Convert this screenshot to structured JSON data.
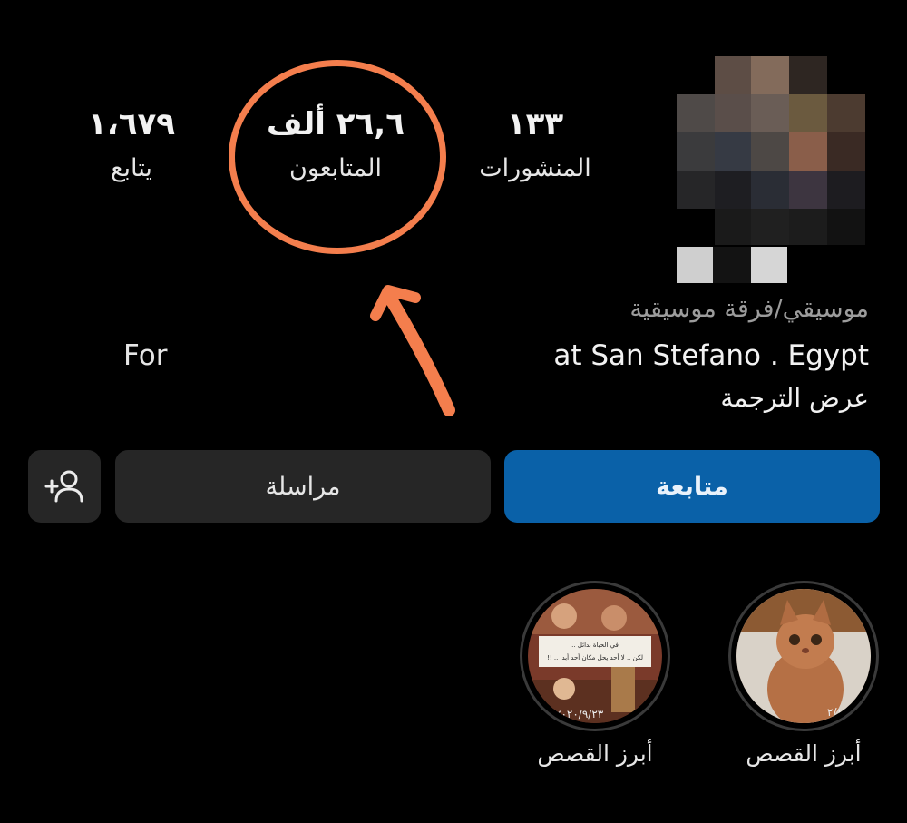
{
  "stats": {
    "posts": {
      "value": "١٣٣",
      "label": "المنشورات"
    },
    "followers": {
      "value": "٢٦,٦ ألف",
      "label": "المتابعون"
    },
    "following": {
      "value": "١،٦٧٩",
      "label": "يتابع"
    }
  },
  "bio": {
    "category": "موسيقي/فرقة موسيقية",
    "location": "at San Stefano . Egypt",
    "for_text": "For",
    "see_translation": "عرض الترجمة"
  },
  "buttons": {
    "follow": "متابعة",
    "message": "مراسلة",
    "add_user_icon": "add-user-icon"
  },
  "highlights": [
    {
      "label": "أبرز القصص",
      "date": "٢/١١/١٣"
    },
    {
      "label": "أبرز القصص",
      "caption": "في الحياة بدائل .. لكن .. لا أحد يحل مكان أحد أبدا .. !!",
      "date": "٢٠٢٠/٩/٢٣"
    }
  ],
  "colors": {
    "annotation": "#f47e4d",
    "follow_button": "#0a61a8",
    "secondary_button": "#262626"
  }
}
